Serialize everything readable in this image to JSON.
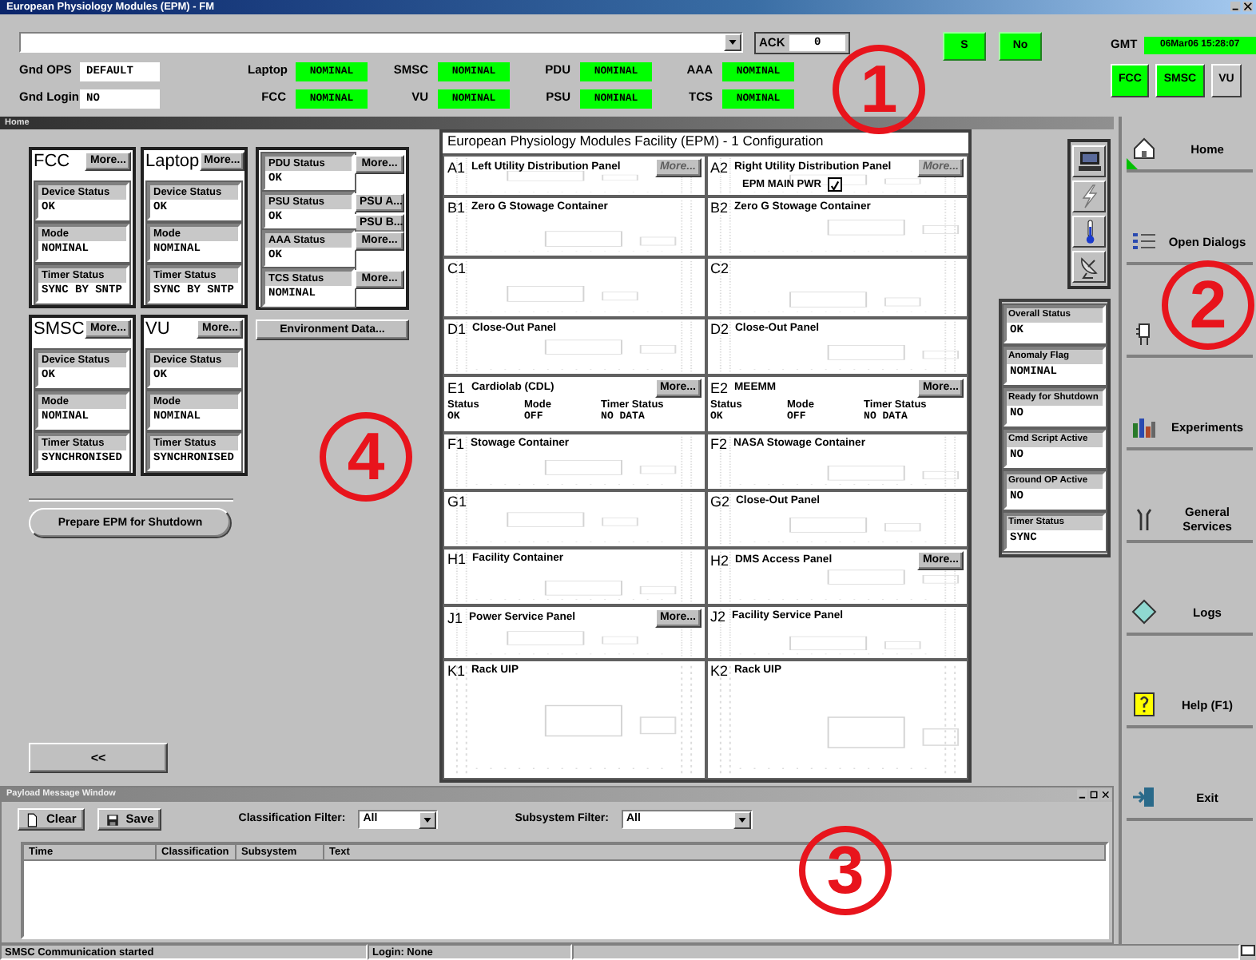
{
  "window": {
    "title": "European Physiology Modules (EPM) - FM"
  },
  "ack": {
    "label": "ACK",
    "value": "0"
  },
  "quick_buttons": [
    {
      "label": "S"
    },
    {
      "label": "No"
    }
  ],
  "gmt": {
    "label": "GMT",
    "value": "06Mar06 15:28:07"
  },
  "ground_fields": [
    {
      "label": "Gnd OPS",
      "value": "DEFAULT"
    },
    {
      "label": "Gnd Login",
      "value": "NO"
    }
  ],
  "subsystems": [
    {
      "label": "Laptop",
      "value": "NOMINAL"
    },
    {
      "label": "FCC",
      "value": "NOMINAL"
    },
    {
      "label": "SMSC",
      "value": "NOMINAL"
    },
    {
      "label": "VU",
      "value": "NOMINAL"
    },
    {
      "label": "PDU",
      "value": "NOMINAL"
    },
    {
      "label": "PSU",
      "value": "NOMINAL"
    },
    {
      "label": "AAA",
      "value": "NOMINAL"
    },
    {
      "label": "TCS",
      "value": "NOMINAL"
    }
  ],
  "connections": [
    {
      "label": "FCC",
      "active": true
    },
    {
      "label": "SMSC",
      "active": true
    },
    {
      "label": "VU",
      "active": false
    }
  ],
  "header_bar": {
    "title": "Home"
  },
  "devices": [
    {
      "name": "FCC",
      "button": "More...",
      "fields": [
        {
          "label": "Device Status",
          "value": "OK"
        },
        {
          "label": "Mode",
          "value": "NOMINAL"
        },
        {
          "label": "Timer Status",
          "value": "SYNC BY SNTP"
        }
      ]
    },
    {
      "name": "Laptop",
      "button": "More...",
      "fields": [
        {
          "label": "Device Status",
          "value": "OK"
        },
        {
          "label": "Mode",
          "value": "NOMINAL"
        },
        {
          "label": "Timer Status",
          "value": "SYNC BY SNTP"
        }
      ]
    },
    {
      "name": "SMSC",
      "button": "More...",
      "fields": [
        {
          "label": "Device Status",
          "value": "OK"
        },
        {
          "label": "Mode",
          "value": "NOMINAL"
        },
        {
          "label": "Timer Status",
          "value": "SYNCHRONISED"
        }
      ]
    },
    {
      "name": "VU",
      "button": "More...",
      "fields": [
        {
          "label": "Device Status",
          "value": "OK"
        },
        {
          "label": "Mode",
          "value": "NOMINAL"
        },
        {
          "label": "Timer Status",
          "value": "SYNCHRONISED"
        }
      ]
    }
  ],
  "power_units": [
    {
      "label": "PDU Status",
      "value": "OK",
      "buttons": [
        "More..."
      ]
    },
    {
      "label": "PSU Status",
      "value": "OK",
      "buttons": [
        "PSU A...",
        "PSU B..."
      ]
    },
    {
      "label": "AAA Status",
      "value": "OK",
      "buttons": [
        "More..."
      ]
    },
    {
      "label": "TCS Status",
      "value": "NOMINAL",
      "buttons": [
        "More..."
      ]
    }
  ],
  "environment_button": "Environment Data...",
  "shutdown_button": "Prepare EPM for Shutdown",
  "collapse_button": "<<",
  "configuration": {
    "title": "European Physiology Modules Facility (EPM) - 1 Configuration",
    "slots": [
      {
        "code": "A1",
        "name": "Left Utility Distribution Panel",
        "more": {
          "label": "More...",
          "disabled": true
        }
      },
      {
        "code": "A2",
        "name": "Right Utility Distribution Panel",
        "more": {
          "label": "More...",
          "disabled": true
        },
        "checkbox": {
          "label": "EPM MAIN PWR",
          "checked": true
        }
      },
      {
        "code": "B1",
        "name": "Zero G Stowage Container"
      },
      {
        "code": "B2",
        "name": "Zero G Stowage Container"
      },
      {
        "code": "C1"
      },
      {
        "code": "C2"
      },
      {
        "code": "D1",
        "name": "Close-Out Panel"
      },
      {
        "code": "D2",
        "name": "Close-Out Panel"
      },
      {
        "code": "E1",
        "name": "Cardiolab (CDL)",
        "more": {
          "label": "More...",
          "disabled": false
        },
        "readouts": [
          {
            "label": "Status",
            "value": "OK"
          },
          {
            "label": "Mode",
            "value": "OFF"
          },
          {
            "label": "Timer Status",
            "value": "NO DATA"
          }
        ]
      },
      {
        "code": "E2",
        "name": "MEEMM",
        "more": {
          "label": "More...",
          "disabled": false
        },
        "readouts": [
          {
            "label": "Status",
            "value": "OK"
          },
          {
            "label": "Mode",
            "value": "OFF"
          },
          {
            "label": "Timer Status",
            "value": "NO DATA"
          }
        ]
      },
      {
        "code": "F1",
        "name": "Stowage Container"
      },
      {
        "code": "F2",
        "name": "NASA Stowage Container"
      },
      {
        "code": "G1"
      },
      {
        "code": "G2",
        "name": "Close-Out Panel"
      },
      {
        "code": "H1",
        "name": "Facility Container"
      },
      {
        "code": "H2",
        "name": "DMS Access Panel",
        "more": {
          "label": "More...",
          "disabled": false
        }
      },
      {
        "code": "J1",
        "name": "Power Service Panel",
        "more": {
          "label": "More...",
          "disabled": false
        }
      },
      {
        "code": "J2",
        "name": "Facility Service Panel"
      },
      {
        "code": "K1",
        "name": "Rack UIP"
      },
      {
        "code": "K2",
        "name": "Rack UIP"
      }
    ]
  },
  "status_panel": [
    {
      "label": "Overall Status",
      "value": "OK"
    },
    {
      "label": "Anomaly Flag",
      "value": "NOMINAL"
    },
    {
      "label": "Ready for Shutdown",
      "value": "NO"
    },
    {
      "label": "Cmd Script Active",
      "value": "NO"
    },
    {
      "label": "Ground OP Active",
      "value": "NO"
    },
    {
      "label": "Timer Status",
      "value": "SYNC"
    }
  ],
  "nav": [
    {
      "label": "Home",
      "selected": true
    },
    {
      "label": "Open Dialogs",
      "selected": false
    },
    {
      "selected": false
    },
    {
      "label": "Experiments",
      "selected": false
    },
    {
      "label": "General Services",
      "selected": false
    },
    {
      "label": "Logs",
      "selected": false
    },
    {
      "label": "Help (F1)",
      "selected": false
    },
    {
      "label": "Exit",
      "selected": false
    }
  ],
  "message_window": {
    "title": "Payload Message Window",
    "buttons": [
      "Clear",
      "Save"
    ],
    "filters": [
      {
        "label": "Classification Filter:",
        "value": "All"
      },
      {
        "label": "Subsystem Filter:",
        "value": "All"
      }
    ],
    "columns": [
      "Time",
      "Classification",
      "Subsystem",
      "Text"
    ]
  },
  "status_bar": [
    "SMSC Communication started",
    "Login: None"
  ],
  "callouts": [
    "1",
    "2",
    "3",
    "4"
  ]
}
